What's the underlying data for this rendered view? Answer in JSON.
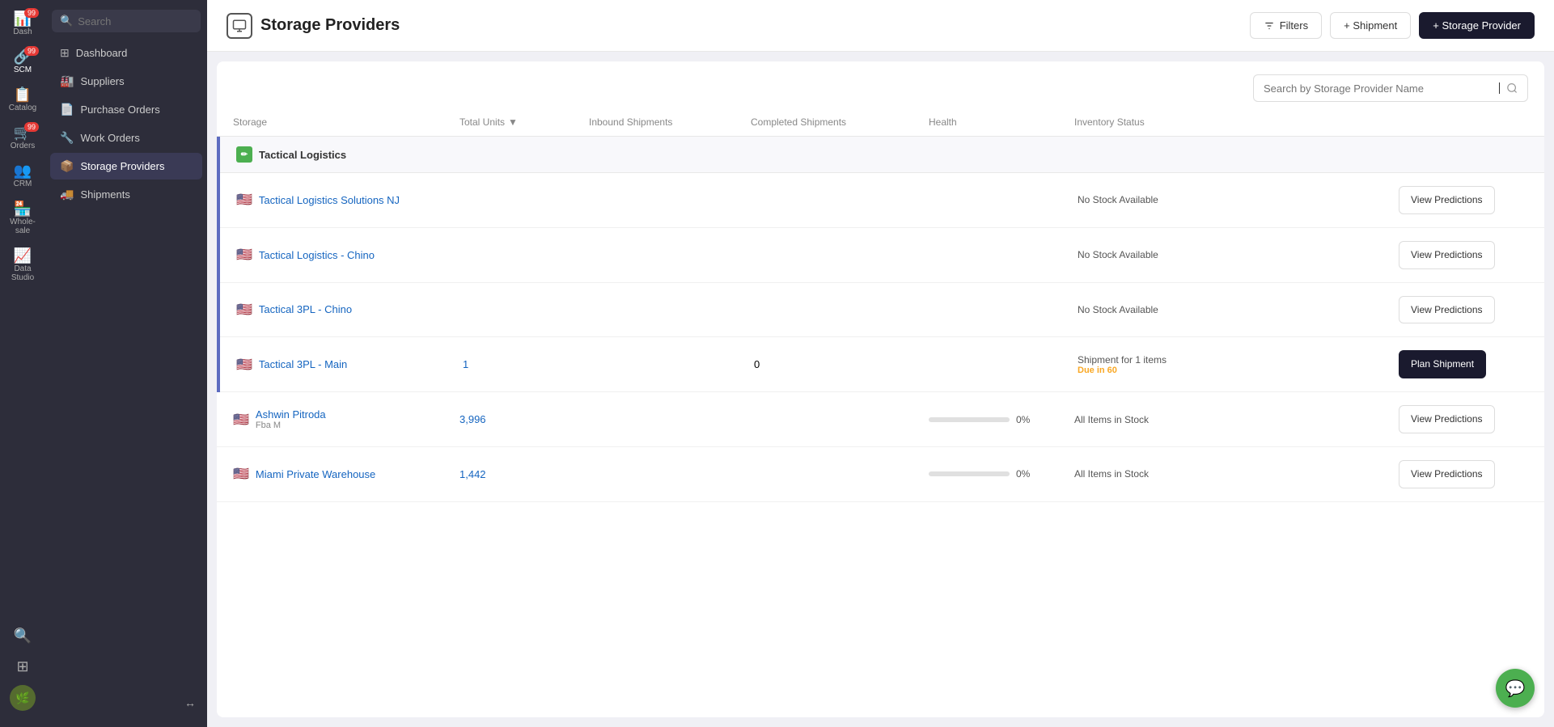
{
  "iconRail": {
    "items": [
      {
        "id": "dash",
        "label": "Dash",
        "icon": "📊",
        "badge": "99",
        "active": false
      },
      {
        "id": "scm",
        "label": "SCM",
        "icon": "🔗",
        "badge": "99",
        "active": true
      },
      {
        "id": "catalog",
        "label": "Catalog",
        "icon": "📋",
        "badge": null,
        "active": false
      },
      {
        "id": "orders",
        "label": "Orders",
        "icon": "🛒",
        "badge": "99",
        "active": false
      },
      {
        "id": "crm",
        "label": "CRM",
        "icon": "👥",
        "badge": null,
        "active": false
      },
      {
        "id": "wholesale",
        "label": "Whole-sale",
        "icon": "🏪",
        "badge": null,
        "active": false
      },
      {
        "id": "datastudio",
        "label": "Data Studio",
        "icon": "📈",
        "badge": null,
        "active": false
      },
      {
        "id": "search",
        "label": "",
        "icon": "🔍",
        "badge": null,
        "active": false
      },
      {
        "id": "grid",
        "label": "",
        "icon": "⚏",
        "badge": null,
        "active": false
      }
    ]
  },
  "sidebar": {
    "searchPlaceholder": "Search",
    "navItems": [
      {
        "id": "dashboard",
        "label": "Dashboard",
        "icon": "⊞",
        "active": false
      },
      {
        "id": "suppliers",
        "label": "Suppliers",
        "icon": "🏭",
        "active": false
      },
      {
        "id": "purchase-orders",
        "label": "Purchase Orders",
        "icon": "📄",
        "active": false
      },
      {
        "id": "work-orders",
        "label": "Work Orders",
        "icon": "🔧",
        "active": false
      },
      {
        "id": "storage-providers",
        "label": "Storage Providers",
        "icon": "📦",
        "active": true
      },
      {
        "id": "shipments",
        "label": "Shipments",
        "icon": "🚚",
        "active": false
      }
    ]
  },
  "header": {
    "pageIcon": "📦",
    "pageTitle": "Storage Providers",
    "filtersBtnLabel": "Filters",
    "shipmentBtnLabel": "+ Shipment",
    "storageProviderBtnLabel": "+ Storage Provider"
  },
  "searchBar": {
    "placeholder": "Search by Storage Provider Name"
  },
  "tableHeaders": {
    "storage": "Storage",
    "totalUnits": "Total Units",
    "inboundShipments": "Inbound Shipments",
    "completedShipments": "Completed Shipments",
    "health": "Health",
    "inventoryStatus": "Inventory Status"
  },
  "groups": [
    {
      "id": "tactical-logistics",
      "name": "Tactical Logistics",
      "icon": "✏",
      "rows": [
        {
          "id": "tls-nj",
          "flag": "🇺🇸",
          "name": "Tactical Logistics Solutions NJ",
          "sublabel": null,
          "totalUnits": null,
          "inboundShipments": null,
          "completedShipments": null,
          "healthPct": null,
          "inventoryStatus": "No Stock Available",
          "actionLabel": "View Predictions",
          "actionDark": false
        },
        {
          "id": "tl-chino",
          "flag": "🇺🇸",
          "name": "Tactical Logistics - Chino",
          "sublabel": null,
          "totalUnits": null,
          "inboundShipments": null,
          "completedShipments": null,
          "healthPct": null,
          "inventoryStatus": "No Stock Available",
          "actionLabel": "View Predictions",
          "actionDark": false
        },
        {
          "id": "t3pl-chino",
          "flag": "🇺🇸",
          "name": "Tactical 3PL - Chino",
          "sublabel": null,
          "totalUnits": null,
          "inboundShipments": null,
          "completedShipments": null,
          "healthPct": null,
          "inventoryStatus": "No Stock Available",
          "actionLabel": "View Predictions",
          "actionDark": false
        },
        {
          "id": "t3pl-main",
          "flag": "🇺🇸",
          "name": "Tactical 3PL - Main",
          "sublabel": null,
          "totalUnits": "1",
          "inboundShipments": null,
          "completedShipments": "0",
          "healthPct": null,
          "inventoryStatus": "Shipment for 1 items",
          "inventoryStatusSub": "Due in 60",
          "actionLabel": "Plan Shipment",
          "actionDark": true
        }
      ]
    }
  ],
  "standaloneRows": [
    {
      "id": "ashwin",
      "flag": "🇺🇸",
      "name": "Ashwin Pitroda",
      "sublabel": "Fba M",
      "totalUnits": "3,996",
      "inboundShipments": null,
      "completedShipments": null,
      "healthPct": "0",
      "inventoryStatus": "All Items in Stock",
      "actionLabel": "View Predictions",
      "actionDark": false
    },
    {
      "id": "miami",
      "flag": "🇺🇸",
      "name": "Miami Private Warehouse",
      "sublabel": null,
      "totalUnits": "1,442",
      "inboundShipments": null,
      "completedShipments": null,
      "healthPct": "0",
      "inventoryStatus": "All Items in Stock",
      "actionLabel": "View Predictions",
      "actionDark": false
    }
  ],
  "chat": {
    "icon": "💬"
  }
}
